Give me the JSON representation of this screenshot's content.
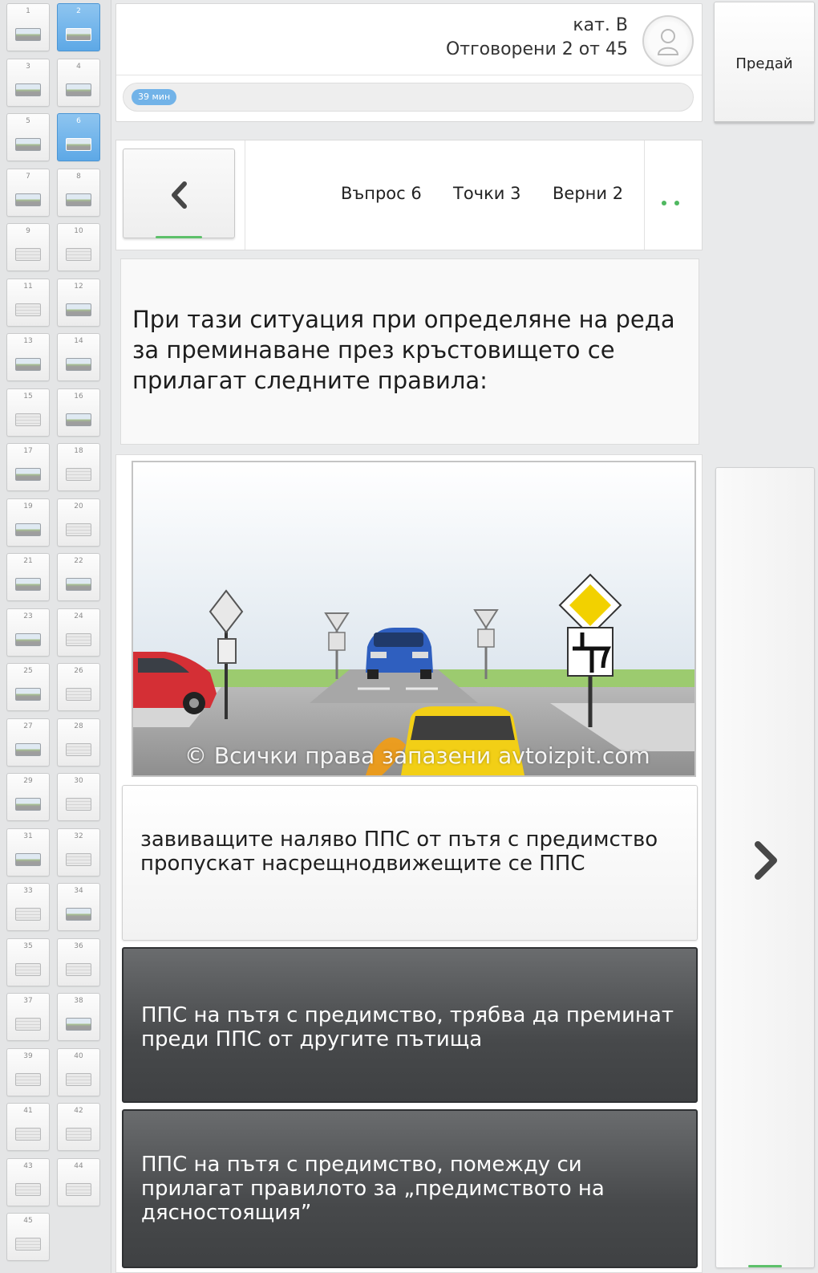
{
  "sidebar": {
    "current": [
      2,
      6
    ],
    "thumbnails": [
      {
        "num": "1",
        "kind": "pic"
      },
      {
        "num": "2",
        "kind": "pic"
      },
      {
        "num": "3",
        "kind": "pic"
      },
      {
        "num": "4",
        "kind": "pic"
      },
      {
        "num": "5",
        "kind": "pic"
      },
      {
        "num": "6",
        "kind": "pic"
      },
      {
        "num": "7",
        "kind": "pic"
      },
      {
        "num": "8",
        "kind": "pic"
      },
      {
        "num": "9",
        "kind": "blank"
      },
      {
        "num": "10",
        "kind": "blank"
      },
      {
        "num": "11",
        "kind": "blank"
      },
      {
        "num": "12",
        "kind": "pic"
      },
      {
        "num": "13",
        "kind": "pic"
      },
      {
        "num": "14",
        "kind": "pic"
      },
      {
        "num": "15",
        "kind": "blank"
      },
      {
        "num": "16",
        "kind": "pic"
      },
      {
        "num": "17",
        "kind": "pic"
      },
      {
        "num": "18",
        "kind": "blank"
      },
      {
        "num": "19",
        "kind": "pic"
      },
      {
        "num": "20",
        "kind": "blank"
      },
      {
        "num": "21",
        "kind": "pic"
      },
      {
        "num": "22",
        "kind": "pic"
      },
      {
        "num": "23",
        "kind": "pic"
      },
      {
        "num": "24",
        "kind": "blank"
      },
      {
        "num": "25",
        "kind": "pic"
      },
      {
        "num": "26",
        "kind": "blank"
      },
      {
        "num": "27",
        "kind": "pic"
      },
      {
        "num": "28",
        "kind": "blank"
      },
      {
        "num": "29",
        "kind": "pic"
      },
      {
        "num": "30",
        "kind": "blank"
      },
      {
        "num": "31",
        "kind": "pic"
      },
      {
        "num": "32",
        "kind": "blank"
      },
      {
        "num": "33",
        "kind": "blank"
      },
      {
        "num": "34",
        "kind": "pic"
      },
      {
        "num": "35",
        "kind": "blank"
      },
      {
        "num": "36",
        "kind": "blank"
      },
      {
        "num": "37",
        "kind": "blank"
      },
      {
        "num": "38",
        "kind": "pic"
      },
      {
        "num": "39",
        "kind": "blank"
      },
      {
        "num": "40",
        "kind": "blank"
      },
      {
        "num": "41",
        "kind": "blank"
      },
      {
        "num": "42",
        "kind": "blank"
      },
      {
        "num": "43",
        "kind": "blank"
      },
      {
        "num": "44",
        "kind": "blank"
      },
      {
        "num": "45",
        "kind": "blank"
      }
    ]
  },
  "header": {
    "category": "кат. В",
    "answered": "Отговорени 2 от  45",
    "timer": "39 мин",
    "avatar_icon": "user-avatar-icon"
  },
  "submit_label": "Предай",
  "nav": {
    "prev_icon": "chevron-left-icon",
    "next_icon": "chevron-right-icon",
    "question_number": "Въпрос 6",
    "points": "Точки 3",
    "correct": "Верни 2",
    "accent_color": "#4fb860"
  },
  "question": {
    "text": "При тази ситуация при определяне на реда за преминаване през кръстовището се прилагат следните правила:"
  },
  "scene": {
    "watermark": "© Всички права запазени avtoizpit.com"
  },
  "answers": [
    {
      "text": "завиващите наляво ППС от пътя с предимство пропускат насрещнодвижещите се ППС",
      "selected": false
    },
    {
      "text": "ППС на пътя с предимство, трябва да преминат преди ППС от другите пътища",
      "selected": true
    },
    {
      "text": "ППС на пътя с предимство, помежду си прилагат правилото за „предимството на дясностоящия”",
      "selected": true
    }
  ],
  "colors": {
    "selected_answer": "#47494b",
    "timer_badge": "#72b3e8",
    "current_thumb": "#5da8e6"
  }
}
